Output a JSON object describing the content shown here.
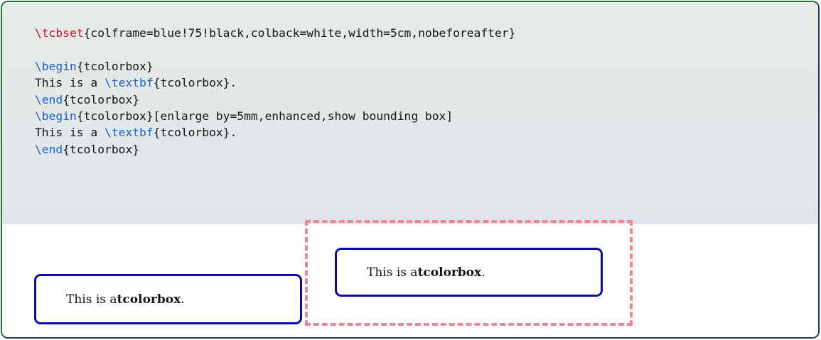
{
  "code_lines": [
    [
      {
        "t": "\\tcbset",
        "c": "red"
      },
      {
        "t": "{colframe=blue!75!black,colback=white,width=5cm,nobeforeafter}",
        "c": "plain"
      }
    ],
    [],
    [
      {
        "t": "\\begin",
        "c": "blue"
      },
      {
        "t": "{tcolorbox}",
        "c": "plain"
      }
    ],
    [
      {
        "t": "This is a ",
        "c": "plain"
      },
      {
        "t": "\\textbf",
        "c": "blue"
      },
      {
        "t": "{tcolorbox}.",
        "c": "plain"
      }
    ],
    [
      {
        "t": "\\end",
        "c": "blue"
      },
      {
        "t": "{tcolorbox}",
        "c": "plain"
      }
    ],
    [
      {
        "t": "\\begin",
        "c": "blue"
      },
      {
        "t": "{tcolorbox}[enlarge by=5mm,enhanced,show bounding box]",
        "c": "plain"
      }
    ],
    [
      {
        "t": "This is a ",
        "c": "plain"
      },
      {
        "t": "\\textbf",
        "c": "blue"
      },
      {
        "t": "{tcolorbox}.",
        "c": "plain"
      }
    ],
    [
      {
        "t": "\\end",
        "c": "blue"
      },
      {
        "t": "{tcolorbox}",
        "c": "plain"
      }
    ]
  ],
  "box1": {
    "prefix": "This is a ",
    "bold": "tcolorbox",
    "suffix": "."
  },
  "box2": {
    "prefix": "This is a ",
    "bold": "tcolorbox",
    "suffix": "."
  },
  "colors": {
    "frame": "#0a0aa8",
    "bounding_box": "#ee8790",
    "code_keyword_red": "#c8102e",
    "code_keyword_blue": "#1a5fd0"
  }
}
